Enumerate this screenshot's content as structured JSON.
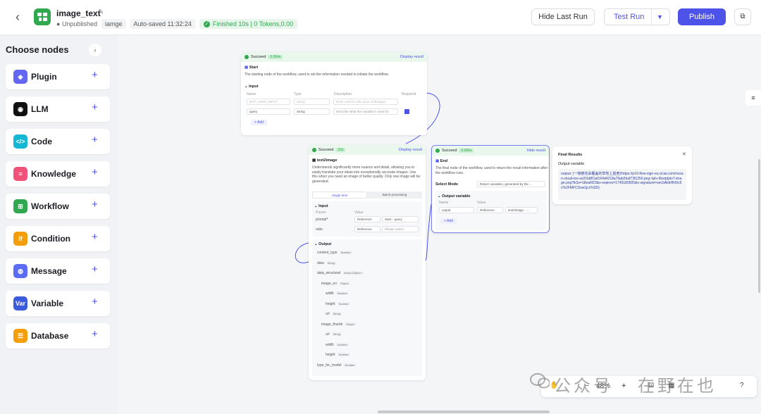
{
  "header": {
    "app_title": "image_text",
    "status": "Unpublished",
    "owner": "iamge",
    "autosave": "Auto-saved 11:32:24",
    "run_status": "Finished 10s | 0 Tokens,0.00",
    "hide_last_run": "Hide Last Run",
    "test_run": "Test Run",
    "publish": "Publish"
  },
  "sidebar": {
    "title": "Choose nodes",
    "items": [
      {
        "label": "Plugin",
        "color": "#6366f1",
        "icon": "plugin-icon",
        "glyph": "◈"
      },
      {
        "label": "LLM",
        "color": "#111111",
        "icon": "llm-icon",
        "glyph": "◉"
      },
      {
        "label": "Code",
        "color": "#14b8d4",
        "icon": "code-icon",
        "glyph": "</>"
      },
      {
        "label": "Knowledge",
        "color": "#f0527a",
        "icon": "knowledge-icon",
        "glyph": "≡"
      },
      {
        "label": "Workflow",
        "color": "#2fa84f",
        "icon": "workflow-icon",
        "glyph": "⊞"
      },
      {
        "label": "Condition",
        "color": "#f59e0b",
        "icon": "condition-icon",
        "glyph": "If"
      },
      {
        "label": "Message",
        "color": "#5b6cf5",
        "icon": "message-icon",
        "glyph": "◍"
      },
      {
        "label": "Variable",
        "color": "#3b5bdb",
        "icon": "variable-icon",
        "glyph": "Var"
      },
      {
        "label": "Database",
        "color": "#f59e0b",
        "icon": "database-icon",
        "glyph": "☰"
      }
    ]
  },
  "start_node": {
    "status": "Succeed",
    "time": "0.004s",
    "link": "Display result",
    "title": "Start",
    "desc": "The starting node of the workflow, used to set the information needed to initiate the workflow.",
    "input_label": "Input",
    "col_name": "Name",
    "col_type": "Type",
    "col_desc": "Description",
    "col_required": "Required",
    "row1_name": "BOT_USER_INPUT",
    "row1_type": "String",
    "row1_desc": "Enter used for this input of dialogue",
    "row2_name": "query",
    "row2_type": "String",
    "row2_desc": "Describe what the variable is used for",
    "add": "+ Add"
  },
  "text2image_node": {
    "status": "Succeed",
    "time": "10s",
    "link": "Display result",
    "title": "text2image",
    "desc": "Understands significantly more nuance and detail, allowing you to easily translate your ideas into exceptionally accurate images. Use this when you need an image of better quality. Only one image will be generated.",
    "tab_single": "Single time",
    "tab_batch": "Batch processing",
    "input_label": "Input",
    "col_param": "Param",
    "col_value": "Value",
    "prompt": "prompt*",
    "prompt_ref": "Reference",
    "prompt_val": "Start - query",
    "ratio": "ratio",
    "ratio_ref": "Reference",
    "ratio_val": "Please select",
    "output_label": "Output",
    "outputs": [
      {
        "name": "content_type",
        "type": "Number",
        "indent": 0
      },
      {
        "name": "data",
        "type": "String",
        "indent": 0
      },
      {
        "name": "data_structural",
        "type": "Array<Object>",
        "indent": 0
      },
      {
        "name": "image_ori",
        "type": "Object",
        "indent": 1
      },
      {
        "name": "width",
        "type": "Number",
        "indent": 2
      },
      {
        "name": "height",
        "type": "Number",
        "indent": 2
      },
      {
        "name": "url",
        "type": "String",
        "indent": 2
      },
      {
        "name": "image_thumb",
        "type": "Object",
        "indent": 1
      },
      {
        "name": "url",
        "type": "String",
        "indent": 2
      },
      {
        "name": "width",
        "type": "Number",
        "indent": 2
      },
      {
        "name": "height",
        "type": "Number",
        "indent": 2
      },
      {
        "name": "type_for_model",
        "type": "Number",
        "indent": 0
      }
    ]
  },
  "end_node": {
    "status": "Succeed",
    "time": "0.006s",
    "link": "Hide result",
    "title": "End",
    "desc": "The final node of the workflow, used to return the result information after the workflow runs.",
    "select_mode": "Select Mode",
    "mode_value": "Return variables, generated by the ...",
    "output_var": "Output variable",
    "col_name": "Name",
    "col_value": "Value",
    "out_name": "output",
    "out_ref": "Reference",
    "out_val": "text2image - ...",
    "add": "+ Add"
  },
  "result_panel": {
    "title": "Final Results",
    "subtitle": "Output variable",
    "text": "output: {一幢被花朵覆盖的草地上屋舍}!https://p16-flow-sign-va.ciciai.com/ocean-cloud-tos-us/01d8f1af164d4218a79ab2baf73f1250.png~tplv-6bxrjdptv7-image.png?lk3s=18ea6f23&x-expires=1749180505&x-signature=seLbAkbHhI5v5c%2FMFCSow1jcc%3D)"
  },
  "toolbar": {
    "zoom": "48%"
  },
  "watermark": "公众号 · 在野在也"
}
